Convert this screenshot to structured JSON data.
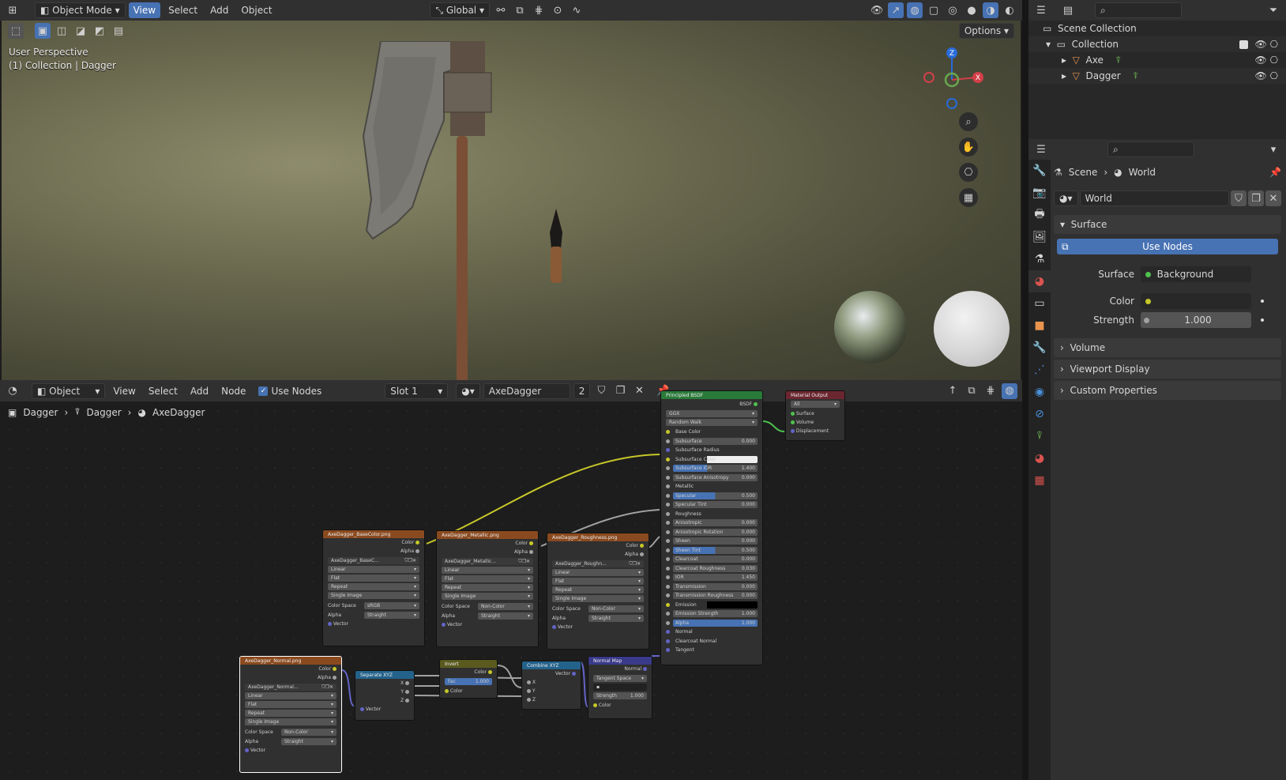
{
  "topbar": {
    "mode": "Object Mode",
    "menus": [
      "View",
      "Select",
      "Add",
      "Object"
    ],
    "orientation": "Global",
    "options": "Options"
  },
  "viewport": {
    "perspective": "User Perspective",
    "collection": "(1) Collection | Dagger",
    "gizmo": {
      "z": "Z",
      "x": "X"
    }
  },
  "outliner": {
    "root": "Scene Collection",
    "collection": "Collection",
    "items": [
      "Axe",
      "Dagger"
    ]
  },
  "props": {
    "breadcrumb": [
      "Scene",
      "World"
    ],
    "world_name": "World",
    "surface_label": "Surface",
    "use_nodes": "Use Nodes",
    "surface_field_label": "Surface",
    "surface_value": "Background",
    "color_label": "Color",
    "strength_label": "Strength",
    "strength_value": "1.000",
    "panels": [
      "Volume",
      "Viewport Display",
      "Custom Properties"
    ]
  },
  "node_header": {
    "editor": "Object",
    "menus": [
      "View",
      "Select",
      "Add",
      "Node"
    ],
    "use_nodes": "Use Nodes",
    "slot": "Slot 1",
    "material": "AxeDagger",
    "users": "2",
    "breadcrumb": [
      "Dagger",
      "Dagger",
      "AxeDagger"
    ]
  },
  "nodes": {
    "bsdf": {
      "title": "Principled BSDF",
      "out": "BSDF",
      "dist": "GGX",
      "sss": "Random Walk",
      "rows": [
        [
          "Base Color",
          ""
        ],
        [
          "Subsurface",
          "0.000"
        ],
        [
          "Subsurface Radius",
          ""
        ],
        [
          "Subsurface Color",
          ""
        ],
        [
          "Subsurface IOR",
          "1.400"
        ],
        [
          "Subsurface Anisotropy",
          "0.000"
        ],
        [
          "Metallic",
          ""
        ],
        [
          "Specular",
          "0.500"
        ],
        [
          "Specular Tint",
          "0.000"
        ],
        [
          "Roughness",
          ""
        ],
        [
          "Anisotropic",
          "0.000"
        ],
        [
          "Anisotropic Rotation",
          "0.000"
        ],
        [
          "Sheen",
          "0.000"
        ],
        [
          "Sheen Tint",
          "0.500"
        ],
        [
          "Clearcoat",
          "0.000"
        ],
        [
          "Clearcoat Roughness",
          "0.030"
        ],
        [
          "IOR",
          "1.450"
        ],
        [
          "Transmission",
          "0.000"
        ],
        [
          "Transmission Roughness",
          "0.000"
        ],
        [
          "Emission",
          ""
        ],
        [
          "Emission Strength",
          "1.000"
        ],
        [
          "Alpha",
          "1.000"
        ],
        [
          "Normal",
          ""
        ],
        [
          "Clearcoat Normal",
          ""
        ],
        [
          "Tangent",
          ""
        ]
      ]
    },
    "output": {
      "title": "Material Output",
      "target": "All",
      "inputs": [
        "Surface",
        "Volume",
        "Displacement"
      ]
    },
    "basecolor": {
      "title": "AxeDagger_BaseColor.png",
      "image": "AxeDagger_BaseC...",
      "interp": "Linear",
      "proj": "Flat",
      "ext": "Repeat",
      "src": "Single Image",
      "cs_label": "Color Space",
      "cs": "sRGB",
      "alpha_label": "Alpha",
      "alpha": "Straight"
    },
    "metallic": {
      "title": "AxeDagger_Metallic.png",
      "image": "AxeDagger_Metallic...",
      "interp": "Linear",
      "proj": "Flat",
      "ext": "Repeat",
      "src": "Single Image",
      "cs_label": "Color Space",
      "cs": "Non-Color",
      "alpha_label": "Alpha",
      "alpha": "Straight"
    },
    "roughness": {
      "title": "AxeDagger_Roughness.png",
      "image": "AxeDagger_Roughn...",
      "interp": "Linear",
      "proj": "Flat",
      "ext": "Repeat",
      "src": "Single Image",
      "cs_label": "Color Space",
      "cs": "Non-Color",
      "alpha_label": "Alpha",
      "alpha": "Straight"
    },
    "normal_img": {
      "title": "AxeDagger_Normal.png",
      "image": "AxeDagger_Normal...",
      "interp": "Linear",
      "proj": "Flat",
      "ext": "Repeat",
      "src": "Single Image",
      "cs_label": "Color Space",
      "cs": "Non-Color",
      "alpha_label": "Alpha",
      "alpha": "Straight"
    },
    "sepxyz": {
      "title": "Separate XYZ",
      "outs": [
        "X",
        "Y",
        "Z"
      ],
      "in": "Vector"
    },
    "invert": {
      "title": "Invert",
      "out": "Color",
      "fac_label": "Fac",
      "fac": "1.000",
      "in": "Color"
    },
    "combxyz": {
      "title": "Combine XYZ",
      "out": "Vector",
      "ins": [
        "X",
        "Y",
        "Z"
      ]
    },
    "normalmap": {
      "title": "Normal Map",
      "out": "Normal",
      "space": "Tangent Space",
      "strength_label": "Strength",
      "strength": "1.000",
      "in": "Color"
    },
    "common": {
      "color": "Color",
      "alpha": "Alpha",
      "vector": "Vector"
    }
  }
}
